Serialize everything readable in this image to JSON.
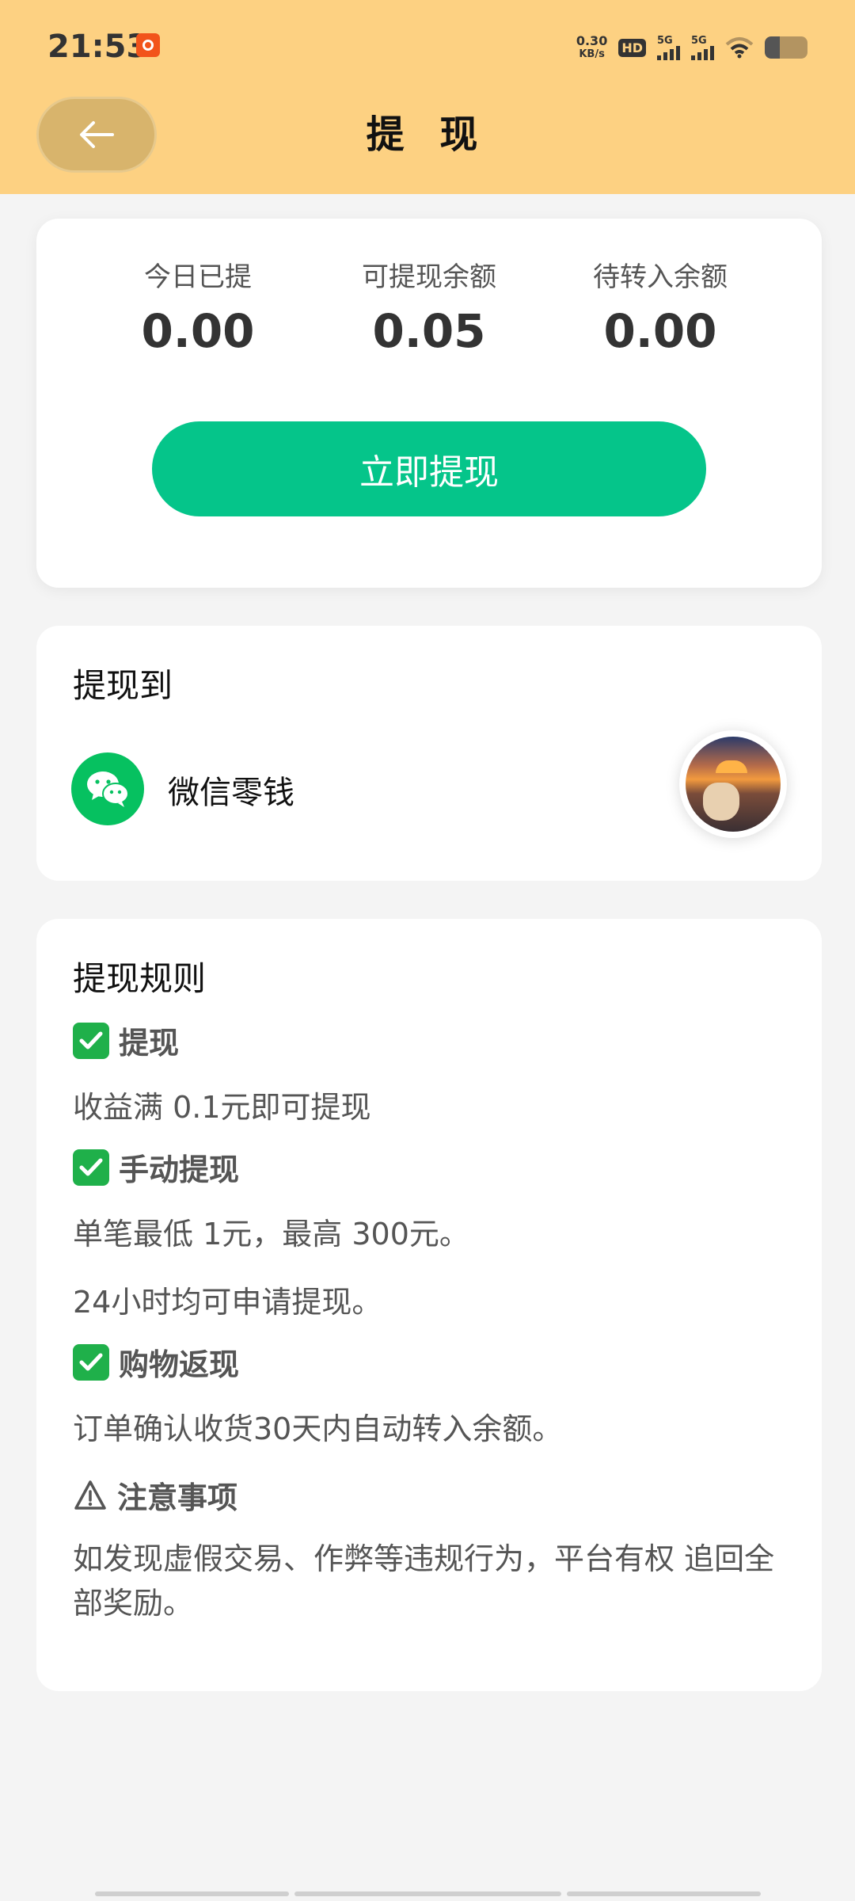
{
  "status_bar": {
    "time": "21:53",
    "speed_value": "0.30",
    "speed_unit": "KB/s",
    "hd_label": "HD",
    "hd_sim": "1 2",
    "sim1_label": "5G",
    "sim2_label": "5G",
    "battery_level": 0.36
  },
  "header": {
    "title": "提 现",
    "back_icon": "arrow-left-icon",
    "bg_color": "#fdd182"
  },
  "balance": {
    "stats": [
      {
        "label": "今日已提",
        "value": "0.00"
      },
      {
        "label": "可提现余额",
        "value": "0.05"
      },
      {
        "label": "待转入余额",
        "value": "0.00"
      }
    ],
    "withdraw_button": "立即提现",
    "button_color": "#05c58a"
  },
  "target": {
    "title": "提现到",
    "method_label": "微信零钱",
    "method_icon": "wechat-icon"
  },
  "rules": {
    "title": "提现规则",
    "sections": [
      {
        "head": "提现",
        "icon": "check-icon",
        "lines": [
          "收益满 0.1元即可提现"
        ]
      },
      {
        "head": "手动提现",
        "icon": "check-icon",
        "lines": [
          "单笔最低 1元，最高 300元。",
          "24小时均可申请提现。"
        ]
      },
      {
        "head": "购物返现",
        "icon": "check-icon",
        "lines": [
          "订单确认收货30天内自动转入余额。"
        ]
      },
      {
        "head": "注意事项",
        "icon": "warning-icon",
        "lines": [
          "如发现虚假交易、作弊等违规行为，平台有权 追回全部奖励。"
        ]
      }
    ]
  }
}
